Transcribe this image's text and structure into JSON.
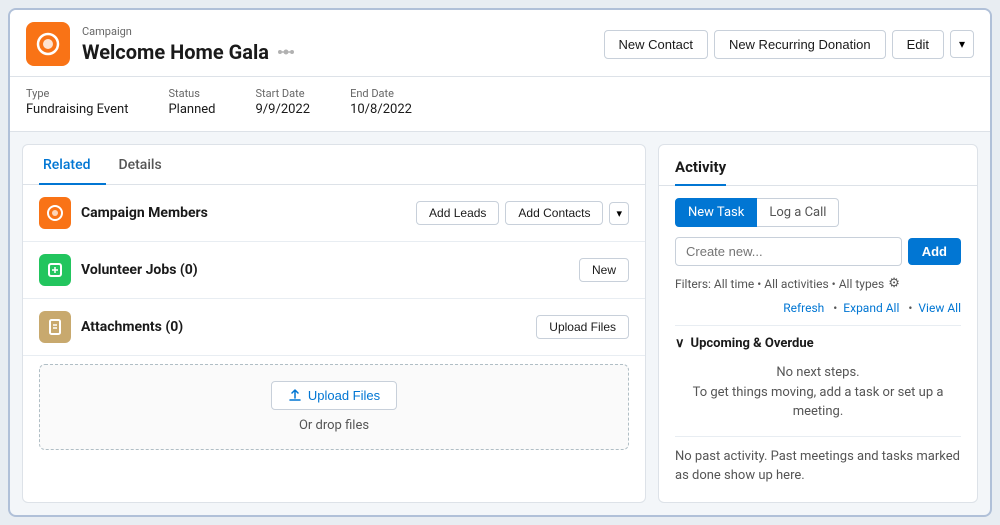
{
  "header": {
    "campaign_label": "Campaign",
    "campaign_title": "Welcome Home Gala",
    "btn_new_contact": "New Contact",
    "btn_new_recurring": "New Recurring Donation",
    "btn_edit": "Edit"
  },
  "meta": {
    "type_label": "Type",
    "type_value": "Fundraising Event",
    "status_label": "Status",
    "status_value": "Planned",
    "start_label": "Start Date",
    "start_value": "9/9/2022",
    "end_label": "End Date",
    "end_value": "10/8/2022"
  },
  "tabs": {
    "related_label": "Related",
    "details_label": "Details"
  },
  "sections": {
    "campaign_members_title": "Campaign Members",
    "btn_add_leads": "Add Leads",
    "btn_add_contacts": "Add Contacts",
    "volunteer_jobs_title": "Volunteer Jobs (0)",
    "btn_new": "New",
    "attachments_title": "Attachments (0)",
    "btn_upload_files": "Upload Files",
    "upload_btn_label": "Upload Files",
    "drop_text": "Or drop files"
  },
  "activity": {
    "title": "Activity",
    "tab_new_task": "New Task",
    "tab_log_call": "Log a Call",
    "create_placeholder": "Create new...",
    "btn_add": "Add",
    "filters_text": "Filters: All time • All activities • All types",
    "link_refresh": "Refresh",
    "link_expand_all": "Expand All",
    "link_view_all": "View All",
    "upcoming_title": "Upcoming & Overdue",
    "upcoming_empty_line1": "No next steps.",
    "upcoming_empty_line2": "To get things moving, add a task or set up a meeting.",
    "past_activity_text": "No past activity. Past meetings and tasks marked as done show up here."
  }
}
